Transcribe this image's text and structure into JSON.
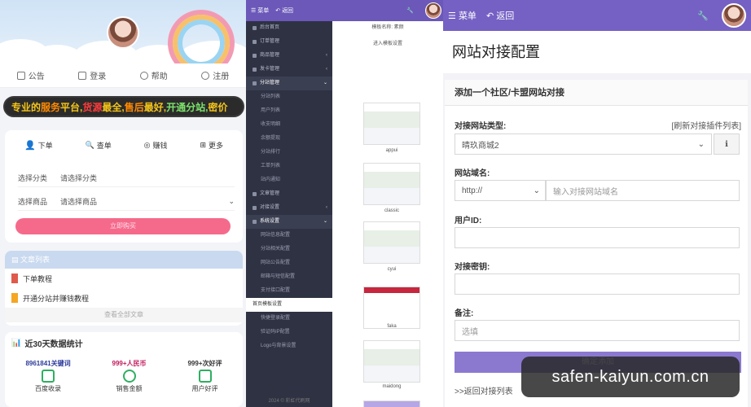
{
  "left": {
    "nav": [
      {
        "label": "公告",
        "icon": "announcement-icon"
      },
      {
        "label": "登录",
        "icon": "login-icon"
      },
      {
        "label": "帮助",
        "icon": "help-icon"
      },
      {
        "label": "注册",
        "icon": "register-icon"
      }
    ],
    "marquee": [
      {
        "text": "专业的",
        "color": "#f5c518"
      },
      {
        "text": "服务",
        "color": "#ff8a00"
      },
      {
        "text": "平台,",
        "color": "#f5c518"
      },
      {
        "text": "货源",
        "color": "#ff3b3b"
      },
      {
        "text": "最全,",
        "color": "#f5c518"
      },
      {
        "text": "售后",
        "color": "#ff8a00"
      },
      {
        "text": "最好,",
        "color": "#f5c518"
      },
      {
        "text": "开通分站,",
        "color": "#7ce36b"
      },
      {
        "text": "密价",
        "color": "#f5c518"
      }
    ],
    "shop_tabs": [
      {
        "label": "下单",
        "icon": "user-icon"
      },
      {
        "label": "查单",
        "icon": "search-icon"
      },
      {
        "label": "赚钱",
        "icon": "coin-icon"
      },
      {
        "label": "更多",
        "icon": "grid-icon"
      }
    ],
    "category": {
      "label": "选择分类",
      "value": "请选择分类"
    },
    "product": {
      "label": "选择商品",
      "value": "请选择商品"
    },
    "buy_button": "立即购买",
    "articles": {
      "title": "文章列表",
      "items": [
        {
          "label": "下单教程",
          "color": "#e05a4c"
        },
        {
          "label": "开通分站并赚钱教程",
          "color": "#f5a623"
        }
      ],
      "more": "查看全部文章"
    },
    "stats": {
      "title": "近30天数据统计",
      "items": [
        {
          "value": "8961841关键词",
          "label": "百度收录",
          "color": "#2b3b9a"
        },
        {
          "value": "999+人民币",
          "label": "销售金额",
          "color": "#c0185a"
        },
        {
          "value": "999+次好评",
          "label": "用户好评",
          "color": "#333333"
        }
      ]
    }
  },
  "middle": {
    "menu_label": "菜单",
    "back_label": "返回",
    "template_name": "模板名称: 素颜",
    "enter_settings": "进入模板设置",
    "sidebar": [
      {
        "label": "后台首页",
        "type": "item"
      },
      {
        "label": "订单管理",
        "type": "item"
      },
      {
        "label": "商品管理",
        "type": "item",
        "arrow": "‹"
      },
      {
        "label": "发卡管理",
        "type": "item",
        "arrow": "‹"
      },
      {
        "label": "分站管理",
        "type": "grp",
        "arrow": "⌄"
      },
      {
        "label": "分站列表",
        "type": "sub"
      },
      {
        "label": "用户列表",
        "type": "sub"
      },
      {
        "label": "收支明细",
        "type": "sub"
      },
      {
        "label": "余额提现",
        "type": "sub"
      },
      {
        "label": "分站排行",
        "type": "sub"
      },
      {
        "label": "工单列表",
        "type": "sub"
      },
      {
        "label": "站内通知",
        "type": "sub"
      },
      {
        "label": "文章管理",
        "type": "item"
      },
      {
        "label": "对接设置",
        "type": "item",
        "arrow": "‹"
      },
      {
        "label": "系统设置",
        "type": "grp",
        "arrow": "⌄"
      },
      {
        "label": "网站信息配置",
        "type": "sub"
      },
      {
        "label": "分站相关配置",
        "type": "sub"
      },
      {
        "label": "网站公告配置",
        "type": "sub"
      },
      {
        "label": "邮箱与短信配置",
        "type": "sub"
      },
      {
        "label": "支付接口配置",
        "type": "sub"
      },
      {
        "label": "首页模板设置",
        "type": "active"
      },
      {
        "label": "快捷登录配置",
        "type": "sub"
      },
      {
        "label": "验证码IP配置",
        "type": "sub"
      },
      {
        "label": "Logo与背景设置",
        "type": "sub"
      }
    ],
    "footer": "2024 © 彩虹代刷网",
    "templates": [
      "appui",
      "classic",
      "cyui",
      "faka",
      "maidong"
    ]
  },
  "right": {
    "menu_label": "菜单",
    "back_label": "返回",
    "page_title": "网站对接配置",
    "form_title": "添加一个社区/卡盟网站对接",
    "type_label": "对接网站类型:",
    "refresh_link": "[刷新对接插件列表]",
    "type_value": "晴玖商城2",
    "domain_label": "网站域名:",
    "protocol": "http://",
    "domain_placeholder": "输入对接网站域名",
    "userid_label": "用户ID:",
    "key_label": "对接密钥:",
    "remark_label": "备注:",
    "remark_placeholder": "选填",
    "submit": "确定添加",
    "back_link": ">>返回对接列表"
  },
  "watermark": "safen-kaiyun.com.cn"
}
